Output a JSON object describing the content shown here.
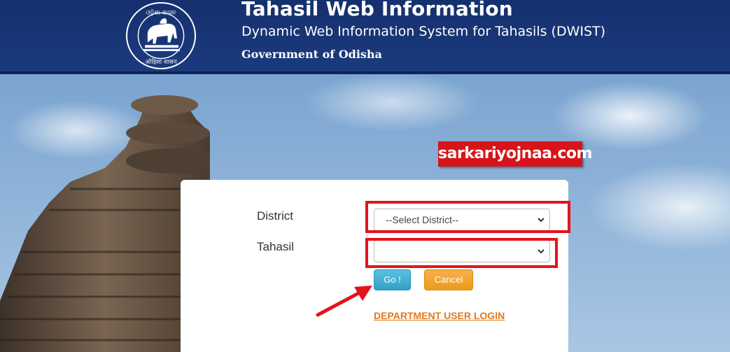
{
  "header": {
    "emblem_top_text": "ଓଡ଼ିଶା ଶାସନ",
    "emblem_bottom_text": "ओड़िशा शासन",
    "title": "Tahasil Web Information",
    "subtitle": "Dynamic Web Information System for Tahasils (DWIST)",
    "government": "Government of Odisha"
  },
  "watermark": {
    "text": "sarkariyojnaa.com"
  },
  "form": {
    "district_label": "District",
    "district_value": "--Select District--",
    "tahasil_label": "Tahasil",
    "tahasil_value": "",
    "go_label": "Go !",
    "cancel_label": "Cancel",
    "department_login_label": "DEPARTMENT USER LOGIN"
  },
  "colors": {
    "header_bg": "#1b3a7e",
    "highlight": "#e2141c",
    "go_button": "#31a1c8",
    "cancel_button": "#ee9a1c",
    "link": "#e07a1a"
  },
  "icons": {
    "emblem": "odisha-emblem-icon",
    "select_chevron": "chevron-down-icon",
    "annotation_arrow": "red-arrow-icon"
  }
}
